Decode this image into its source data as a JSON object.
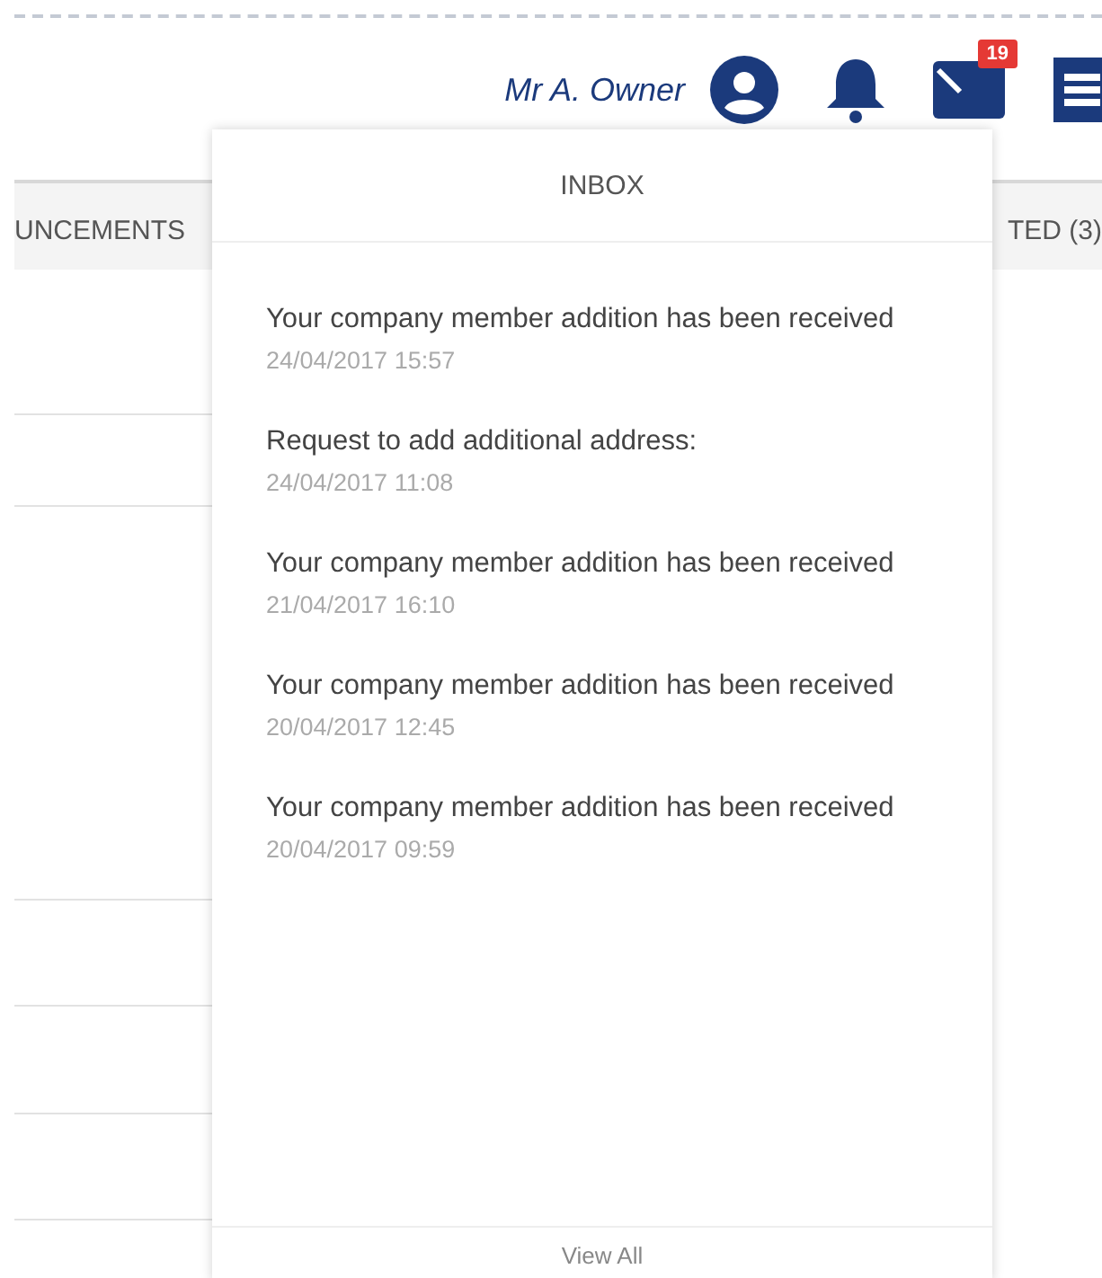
{
  "header": {
    "user_name": "Mr A. Owner",
    "mail_badge": "19"
  },
  "tabs": [
    {
      "label": "UNCEMENTS"
    },
    {
      "label": "TED (3)"
    }
  ],
  "inbox": {
    "title": "INBOX",
    "messages": [
      {
        "text": "Your company member addition has been received",
        "time": "24/04/2017 15:57"
      },
      {
        "text": "Request to add additional address:",
        "time": "24/04/2017 11:08"
      },
      {
        "text": "Your company member addition has been received",
        "time": "21/04/2017 16:10"
      },
      {
        "text": "Your company member addition has been received",
        "time": "20/04/2017 12:45"
      },
      {
        "text": "Your company member addition has been received",
        "time": "20/04/2017 09:59"
      }
    ],
    "footer": "View All"
  }
}
